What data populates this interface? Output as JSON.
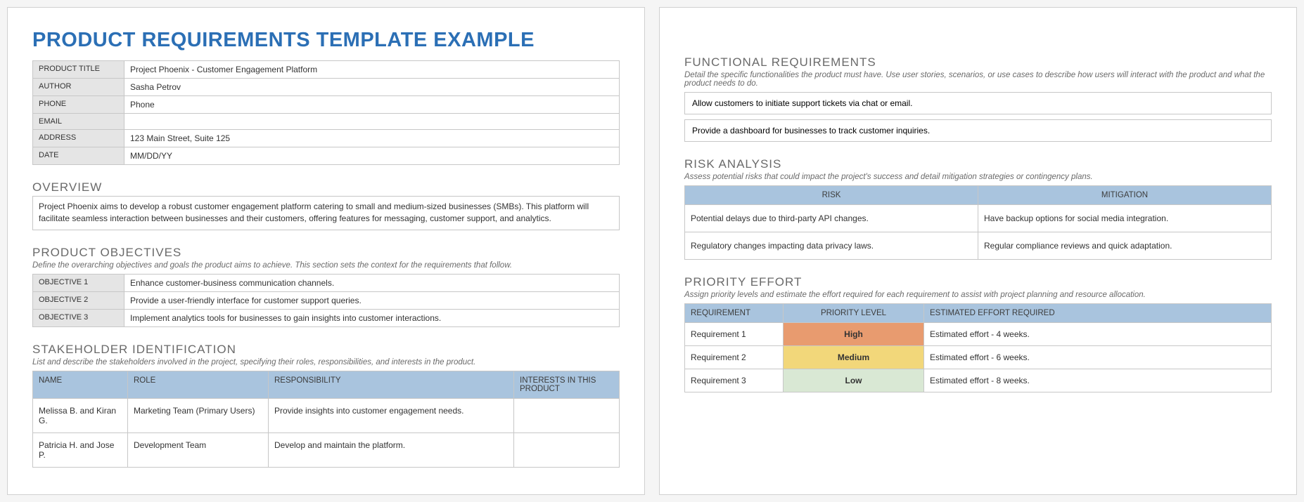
{
  "title": "PRODUCT REQUIREMENTS TEMPLATE EXAMPLE",
  "info": {
    "labels": {
      "product_title": "PRODUCT TITLE",
      "author": "AUTHOR",
      "phone": "PHONE",
      "email": "EMAIL",
      "address": "ADDRESS",
      "date": "DATE"
    },
    "values": {
      "product_title": "Project Phoenix - Customer Engagement Platform",
      "author": "Sasha Petrov",
      "phone": "Phone",
      "email": "",
      "address": "123 Main Street, Suite 125",
      "date": "MM/DD/YY"
    }
  },
  "overview": {
    "heading": "OVERVIEW",
    "text": "Project Phoenix aims to develop a robust customer engagement platform catering to small and medium-sized businesses (SMBs). This platform will facilitate seamless interaction between businesses and their customers, offering features for messaging, customer support, and analytics."
  },
  "objectives": {
    "heading": "PRODUCT OBJECTIVES",
    "sub": "Define the overarching objectives and goals the product aims to achieve. This section sets the context for the requirements that follow.",
    "rows": [
      {
        "label": "OBJECTIVE 1",
        "text": "Enhance customer-business communication channels."
      },
      {
        "label": "OBJECTIVE 2",
        "text": "Provide a user-friendly interface for customer support queries."
      },
      {
        "label": "OBJECTIVE 3",
        "text": "Implement analytics tools for businesses to gain insights into customer interactions."
      }
    ]
  },
  "stakeholders": {
    "heading": "STAKEHOLDER IDENTIFICATION",
    "sub": "List and describe the stakeholders involved in the project, specifying their roles, responsibilities, and interests in the product.",
    "columns": {
      "name": "NAME",
      "role": "ROLE",
      "resp": "RESPONSIBILITY",
      "interests": "INTERESTS IN THIS PRODUCT"
    },
    "rows": [
      {
        "name": "Melissa B. and Kiran G.",
        "role": "Marketing Team (Primary Users)",
        "resp": "Provide insights into customer engagement needs.",
        "interests": ""
      },
      {
        "name": "Patricia H. and Jose P.",
        "role": "Development Team",
        "resp": "Develop and maintain the platform.",
        "interests": ""
      }
    ]
  },
  "functional": {
    "heading": "FUNCTIONAL REQUIREMENTS",
    "sub": "Detail the specific functionalities the product must have. Use user stories, scenarios, or use cases to describe how users will interact with the product and what the product needs to do.",
    "items": [
      "Allow customers to initiate support tickets via chat or email.",
      "Provide a dashboard for businesses to track customer inquiries."
    ]
  },
  "risk": {
    "heading": "RISK ANALYSIS",
    "sub": "Assess potential risks that could impact the project's success and detail mitigation strategies or contingency plans.",
    "columns": {
      "risk": "RISK",
      "mitigation": "MITIGATION"
    },
    "rows": [
      {
        "risk": "Potential delays due to third-party API changes.",
        "mitigation": "Have backup options for social media integration."
      },
      {
        "risk": "Regulatory changes impacting data privacy laws.",
        "mitigation": "Regular compliance reviews and quick adaptation."
      }
    ]
  },
  "priority": {
    "heading": "PRIORITY EFFORT",
    "sub": "Assign priority levels and estimate the effort required for each requirement to assist with project planning and resource allocation.",
    "columns": {
      "req": "REQUIREMENT",
      "level": "PRIORITY LEVEL",
      "effort": "ESTIMATED EFFORT REQUIRED"
    },
    "rows": [
      {
        "req": "Requirement 1",
        "level": "High",
        "effort": "Estimated effort - 4 weeks.",
        "class": "prio-high"
      },
      {
        "req": "Requirement 2",
        "level": "Medium",
        "effort": "Estimated effort - 6 weeks.",
        "class": "prio-med"
      },
      {
        "req": "Requirement 3",
        "level": "Low",
        "effort": "Estimated effort - 8 weeks.",
        "class": "prio-low"
      }
    ]
  }
}
